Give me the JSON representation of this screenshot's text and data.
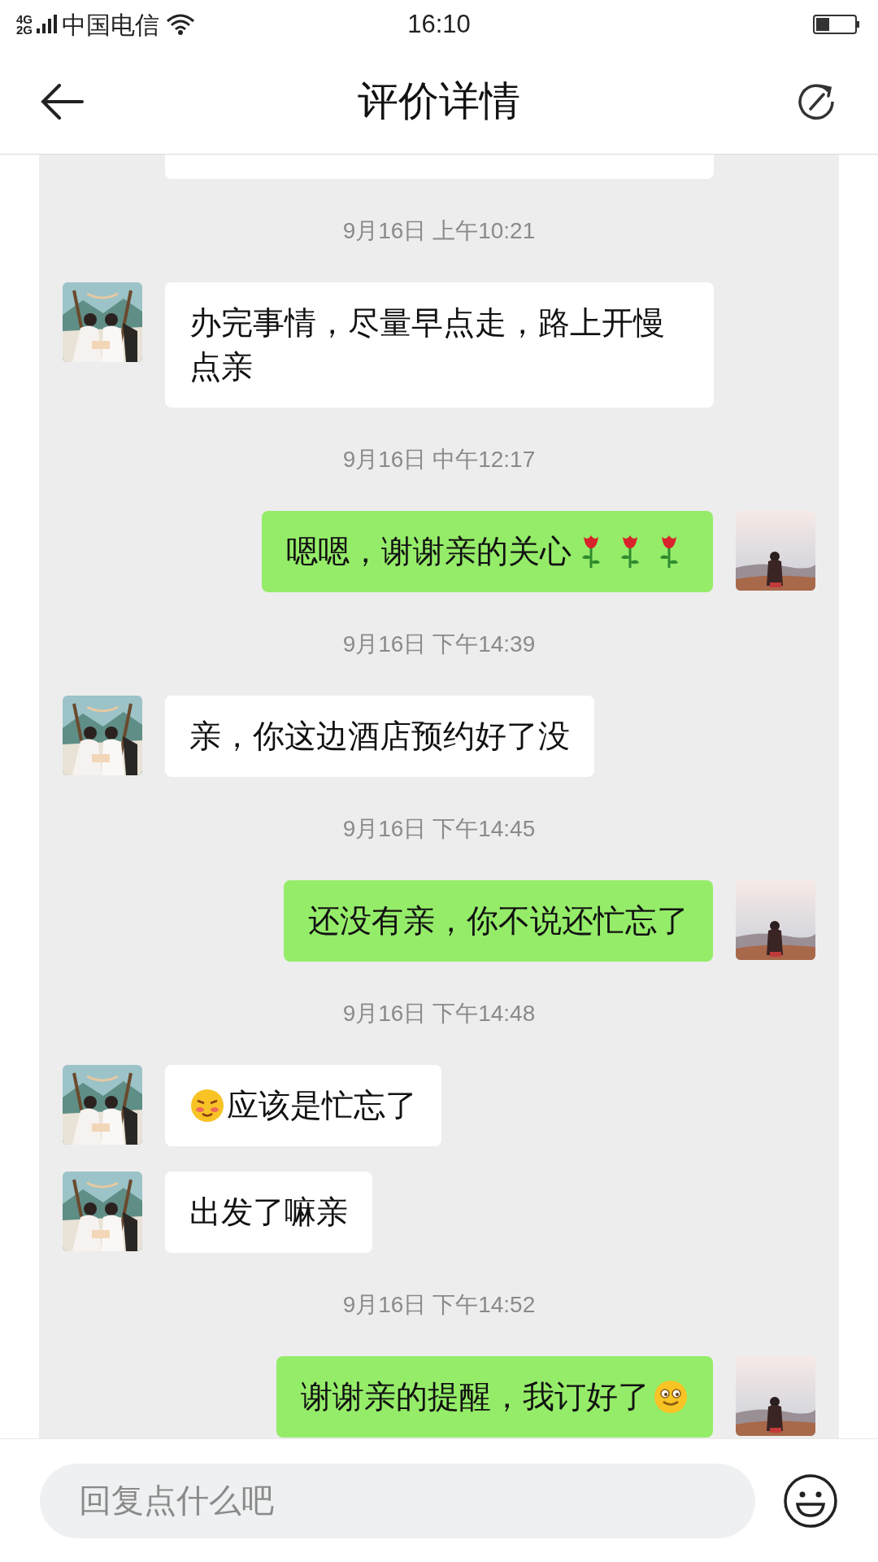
{
  "status_bar": {
    "network_top": "4G",
    "network_bottom": "2G",
    "carrier": "中国电信",
    "time": "16:10"
  },
  "header": {
    "title": "评价详情"
  },
  "chat": [
    {
      "kind": "cut_bubble"
    },
    {
      "kind": "time",
      "text": "9月16日 上午10:21"
    },
    {
      "kind": "message",
      "outgoing": false,
      "text": "办完事情，尽量早点走，路上开慢点亲"
    },
    {
      "kind": "time",
      "text": "9月16日 中午12:17"
    },
    {
      "kind": "message",
      "outgoing": true,
      "text": "嗯嗯，谢谢亲的关心",
      "icons_after": [
        {
          "kind": "rose"
        },
        {
          "kind": "rose"
        },
        {
          "kind": "rose"
        }
      ]
    },
    {
      "kind": "time",
      "text": "9月16日 下午14:39"
    },
    {
      "kind": "message",
      "outgoing": false,
      "text": "亲，你这边酒店预约好了没"
    },
    {
      "kind": "time",
      "text": "9月16日 下午14:45"
    },
    {
      "kind": "message",
      "outgoing": true,
      "text": "还没有亲，你不说还忙忘了"
    },
    {
      "kind": "time",
      "text": "9月16日 下午14:48"
    },
    {
      "kind": "message",
      "outgoing": false,
      "text": "应该是忙忘了",
      "icons_before": [
        {
          "kind": "blush"
        }
      ]
    },
    {
      "kind": "message",
      "outgoing": false,
      "text": "出发了嘛亲"
    },
    {
      "kind": "time",
      "text": "9月16日 下午14:52"
    },
    {
      "kind": "message",
      "outgoing": true,
      "text": "谢谢亲的提醒，我订好了",
      "icons_after": [
        {
          "kind": "smile"
        }
      ]
    }
  ],
  "reply_bar": {
    "placeholder": "回复点什么吧"
  }
}
